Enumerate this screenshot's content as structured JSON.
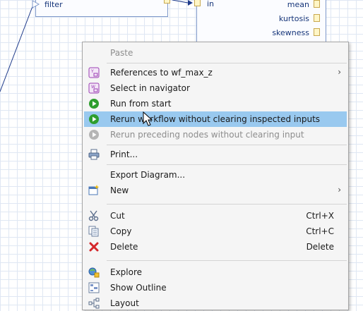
{
  "canvas": {
    "filter_node_label": "filter",
    "in_port_label": "in",
    "outputs": [
      "mean",
      "kurtosis",
      "skewness"
    ]
  },
  "menu": {
    "paste": "Paste",
    "references": "References to wf_max_z",
    "select_navigator": "Select in navigator",
    "run_from_start": "Run from start",
    "rerun_workflow": "Rerun workflow without clearing inspected inputs",
    "rerun_preceding": "Rerun preceding nodes without clearing input",
    "print": "Print...",
    "export_diagram": "Export Diagram...",
    "new": "New",
    "cut": "Cut",
    "cut_shortcut": "Ctrl+X",
    "copy": "Copy",
    "copy_shortcut": "Ctrl+C",
    "delete": "Delete",
    "delete_shortcut": "Delete",
    "explore": "Explore",
    "show_outline": "Show Outline",
    "layout": "Layout"
  },
  "icons": {
    "references": "wf-reference-icon",
    "select_navigator": "wf-navigator-icon",
    "run": "green-run-icon",
    "rerun": "green-rerun-icon",
    "rerun_disabled": "gray-rerun-icon",
    "print": "printer-icon",
    "new": "new-wizard-icon",
    "cut": "scissors-icon",
    "copy": "copy-icon",
    "delete": "red-x-icon",
    "explore": "explore-icon",
    "show_outline": "outline-icon",
    "layout": "layout-icon"
  },
  "colors": {
    "highlight": "#99c9ef",
    "menu_bg": "#f5f5f5",
    "node_border": "#7d97c9",
    "run_green": "#2e9e2e",
    "delete_red": "#d4272b"
  }
}
